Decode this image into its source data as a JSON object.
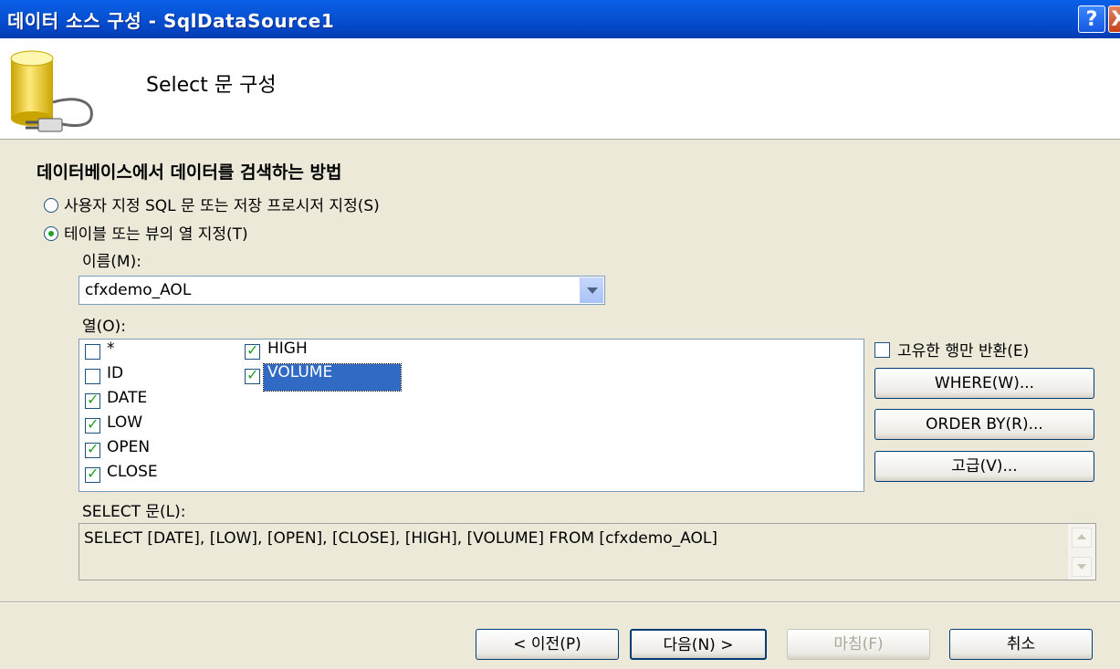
{
  "window": {
    "title": "데이터 소스 구성 - SqlDataSource1",
    "help_label": "?",
    "close_label": "X"
  },
  "header": {
    "title": "Select 문 구성"
  },
  "section": {
    "title": "데이터베이스에서 데이터를 검색하는 방법",
    "option_custom_sql": "사용자 지정 SQL 문 또는 저장 프로시저 지정(S)",
    "option_table_view": "테이블 또는 뷰의 열 지정(T)",
    "selected_option": "table_view"
  },
  "name_field": {
    "label": "이름(M):",
    "value": "cfxdemo_AOL"
  },
  "columns": {
    "label": "열(O):",
    "items": [
      {
        "name": "*",
        "checked": false
      },
      {
        "name": "ID",
        "checked": false
      },
      {
        "name": "DATE",
        "checked": true
      },
      {
        "name": "LOW",
        "checked": true
      },
      {
        "name": "OPEN",
        "checked": true
      },
      {
        "name": "CLOSE",
        "checked": true
      },
      {
        "name": "HIGH",
        "checked": true
      },
      {
        "name": "VOLUME",
        "checked": true,
        "selected": true
      }
    ]
  },
  "distinct": {
    "label": "고유한 행만 반환(E)",
    "checked": false
  },
  "buttons": {
    "where": "WHERE(W)...",
    "order_by": "ORDER BY(R)...",
    "advanced": "고급(V)..."
  },
  "select_statement": {
    "label": "SELECT 문(L):",
    "value": "SELECT [DATE], [LOW], [OPEN], [CLOSE], [HIGH], [VOLUME] FROM [cfxdemo_AOL]"
  },
  "footer": {
    "prev": "< 이전(P)",
    "next": "다음(N) >",
    "finish": "마침(F)",
    "cancel": "취소"
  }
}
